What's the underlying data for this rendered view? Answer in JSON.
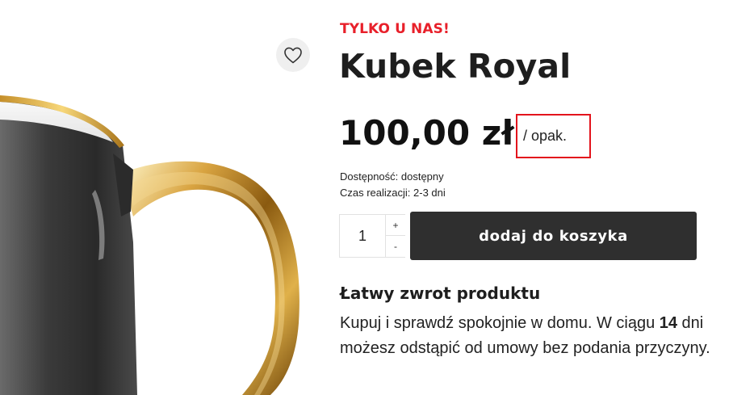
{
  "product": {
    "badge": "TYLKO U NAS!",
    "title": "Kubek Royal",
    "price": "100,00 zł",
    "unit": "/ opak.",
    "availability": "Dostępność: dostępny",
    "delivery": "Czas realizacji: 2-3 dni",
    "image_icon": "product-photo-mug"
  },
  "wishlist": {
    "icon": "heart-icon"
  },
  "quantity": {
    "value": "1",
    "increment_label": "+",
    "decrement_label": "-"
  },
  "cart": {
    "add_label": "dodaj do koszyka"
  },
  "returns": {
    "title": "Łatwy zwrot produktu",
    "text_before": "Kupuj i sprawdź spokojnie w domu. W ciągu ",
    "days": "14",
    "text_after": " dni możesz odstąpić od umowy bez podania przyczyny."
  },
  "colors": {
    "badge_red": "#e8202a",
    "highlight_red": "#e3141c",
    "button_dark": "#2f2f2f"
  }
}
